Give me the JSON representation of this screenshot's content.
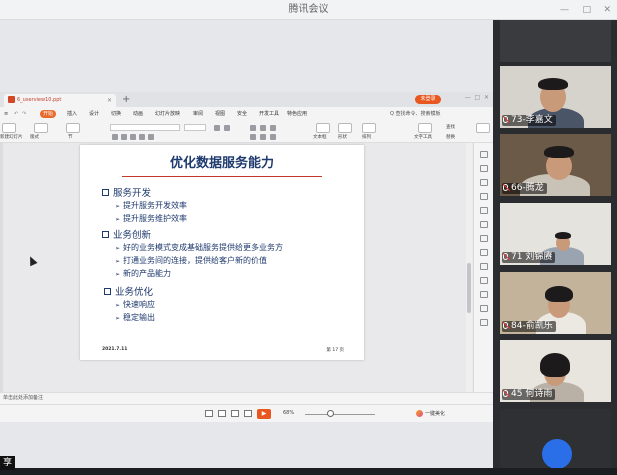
{
  "meeting": {
    "app_title": "腾讯会议",
    "share_tag": "享"
  },
  "wps": {
    "doc_tab": "6_userview10.ppt",
    "login": "未登录",
    "menus": [
      "开始",
      "插入",
      "设计",
      "切换",
      "动画",
      "幻灯片放映",
      "审阅",
      "视图",
      "安全",
      "开发工具",
      "特色应用"
    ],
    "active_menu": "开始",
    "search": "Q 查找命令、搜索模板",
    "ribbon_labels": [
      "新建幻灯片",
      "版式",
      "节",
      "文本框",
      "形状",
      "排列",
      "文字工具",
      "查找",
      "替换"
    ],
    "notes_placeholder": "单击此处添加备注",
    "zoom": "68%",
    "beautify": "一键美化"
  },
  "slide": {
    "title": "优化数据服务能力",
    "sections": [
      {
        "heading": "服务开发",
        "items": [
          "提升服务开发效率",
          "提升服务维护效率"
        ]
      },
      {
        "heading": "业务创新",
        "items": [
          "好的业务模式变成基础服务提供给更多业务方",
          "打通业务间的连接，提供给客户新的价值",
          "新的产品能力"
        ]
      },
      {
        "heading": "业务优化",
        "items": [
          "快速响应",
          "稳定输出"
        ]
      }
    ],
    "date": "2021.7.11",
    "page": "第 17 页"
  },
  "participants": [
    {
      "name": "73-李嘉文"
    },
    {
      "name": "66-腾龙"
    },
    {
      "name": "71 刘锦赓"
    },
    {
      "name": "84-俞凯乐"
    },
    {
      "name": "45 何诗雨"
    }
  ],
  "colors": {
    "accent": "#e8571f",
    "slide_text": "#1f3a6e",
    "slide_rule": "#c0392b"
  }
}
